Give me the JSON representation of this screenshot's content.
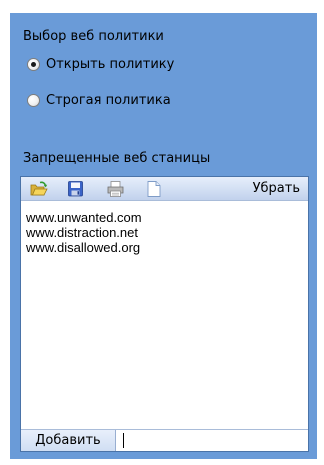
{
  "policy": {
    "title": "Выбор веб политики",
    "options": [
      {
        "label": "Открыть политику",
        "selected": true
      },
      {
        "label": "Строгая политика",
        "selected": false
      }
    ]
  },
  "blocked": {
    "title": "Запрещенные веб станицы",
    "toolbar": {
      "icons": [
        "open-folder-icon",
        "save-disk-icon",
        "print-icon",
        "new-document-icon"
      ],
      "remove_label": "Убрать"
    },
    "sites": [
      "www.unwanted.com",
      "www.distraction.net",
      "www.disallowed.org"
    ],
    "add_label": "Добавить",
    "input_value": ""
  },
  "colors": {
    "panel": "#6a9bd8",
    "toolbar": "#d2dff3"
  }
}
